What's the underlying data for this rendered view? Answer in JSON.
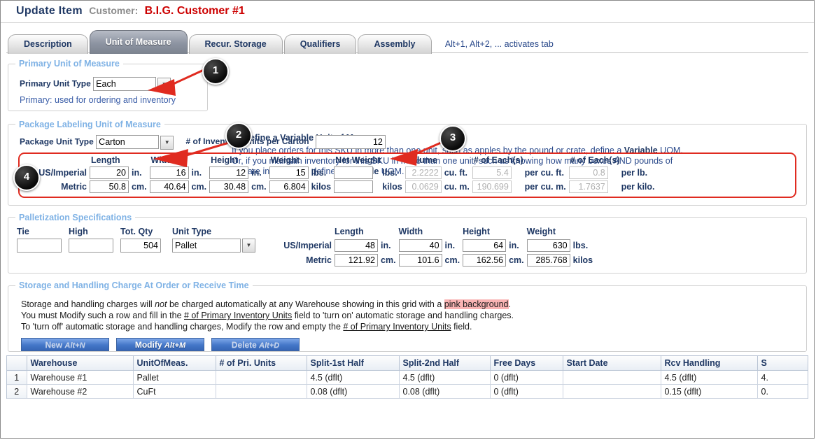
{
  "header": {
    "title_update": "Update",
    "title_item": "Item",
    "customer_label": "Customer:",
    "customer_name": "B.I.G. Customer #1"
  },
  "tabs": [
    {
      "label": "Description",
      "active": false
    },
    {
      "label": "Unit of Measure",
      "active": true
    },
    {
      "label": "Recur. Storage",
      "active": false
    },
    {
      "label": "Qualifiers",
      "active": false
    },
    {
      "label": "Assembly",
      "active": false
    }
  ],
  "tab_hint": "Alt+1, Alt+2, ... activates tab",
  "primary_uom": {
    "legend": "Primary Unit of Measure",
    "unit_type_label": "Primary Unit Type",
    "unit_type_value": "Each",
    "note": "Primary: used for ordering and inventory"
  },
  "variable_uom": {
    "checkbox_label": "Define a Variable Unit of Measure",
    "checked": false,
    "body_1": "If you place orders for this SKU in more than one unit, such as apples by the pound or crate, define a ",
    "body_b1": "Variable",
    "body_2": " UOM. Or, if you maintain inventory for this SKU in more than one unit, such as knowing how many boxes AND pounds of fish are in inventory, define a ",
    "body_b2": "Variable",
    "body_3": " UOM."
  },
  "package_uom": {
    "legend": "Package Labeling Unit of Measure",
    "unit_type_label": "Package Unit Type",
    "unit_type_value": "Carton",
    "inv_units_label": "# of Inventory Units per Carton",
    "inv_units_value": "12",
    "columns": [
      "Length",
      "Width",
      "Height",
      "Weight",
      "Net Weight",
      "Volume",
      "# of Each(s)",
      "# of Each(s)"
    ],
    "rows": [
      {
        "label": "US/Imperial",
        "length": "20",
        "length_unit": "in.",
        "width": "16",
        "width_unit": "in.",
        "height": "12",
        "height_unit": "in.",
        "weight": "15",
        "weight_unit": "lbs.",
        "net_weight": "",
        "net_weight_unit": "lbs.",
        "volume": "2.2222",
        "volume_unit": "cu. ft.",
        "each1": "5.4",
        "each1_unit": "per cu. ft.",
        "each2": "0.8",
        "each2_unit": "per lb."
      },
      {
        "label": "Metric",
        "length": "50.8",
        "length_unit": "cm.",
        "width": "40.64",
        "width_unit": "cm.",
        "height": "30.48",
        "height_unit": "cm.",
        "weight": "6.804",
        "weight_unit": "kilos",
        "net_weight": "",
        "net_weight_unit": "kilos",
        "volume": "0.0629",
        "volume_unit": "cu. m.",
        "each1": "190.699",
        "each1_unit": "per cu. m.",
        "each2": "1.7637",
        "each2_unit": "per kilo."
      }
    ]
  },
  "palletization": {
    "legend": "Palletization Specifications",
    "tie_label": "Tie",
    "tie_value": "",
    "high_label": "High",
    "high_value": "",
    "tot_qty_label": "Tot. Qty",
    "tot_qty_value": "504",
    "unit_type_label": "Unit Type",
    "unit_type_value": "Pallet",
    "columns": [
      "Length",
      "Width",
      "Height",
      "Weight"
    ],
    "rows": [
      {
        "label": "US/Imperial",
        "length": "48",
        "length_unit": "in.",
        "width": "40",
        "width_unit": "in.",
        "height": "64",
        "height_unit": "in.",
        "weight": "630",
        "weight_unit": "lbs."
      },
      {
        "label": "Metric",
        "length": "121.92",
        "length_unit": "cm.",
        "width": "101.6",
        "width_unit": "cm.",
        "height": "162.56",
        "height_unit": "cm.",
        "weight": "285.768",
        "weight_unit": "kilos"
      }
    ]
  },
  "storage": {
    "legend": "Storage and Handling Charge At Order or Receive Time",
    "line1_a": "Storage and handling charges will ",
    "line1_not": "not",
    "line1_b": " be charged automatically at any Warehouse showing in this grid with a ",
    "line1_pink": "pink background",
    "line1_c": ".",
    "line2_a": "You must Modify such a row and fill in the ",
    "line2_link": "# of Primary Inventory Units",
    "line2_b": " field to 'turn on' automatic storage and handling charges.",
    "line3_a": "To 'turn off' automatic storage and handling charges, Modify the row and empty the ",
    "line3_link": "# of Primary Inventory Units",
    "line3_b": " field.",
    "buttons": [
      {
        "label": "New",
        "accel": "Alt+N",
        "disabled": true
      },
      {
        "label": "Modify",
        "accel": "Alt+M",
        "disabled": false
      },
      {
        "label": "Delete",
        "accel": "Alt+D",
        "disabled": true
      }
    ],
    "grid": {
      "columns": [
        "",
        "Warehouse",
        "UnitOfMeas.",
        "# of Pri. Units",
        "Split-1st Half",
        "Split-2nd Half",
        "Free Days",
        "Start Date",
        "Rcv Handling",
        "S"
      ],
      "rows": [
        {
          "num": "1",
          "warehouse": "Warehouse #1",
          "uom": "Pallet",
          "pri_units": "",
          "split1": "4.5 (dflt)",
          "split2": "4.5 (dflt)",
          "free_days": "0 (dflt)",
          "start_date": "",
          "rcv_handling": "4.5 (dflt)",
          "last": "4."
        },
        {
          "num": "2",
          "warehouse": "Warehouse #2",
          "uom": "CuFt",
          "pri_units": "",
          "split1": "0.08 (dflt)",
          "split2": "0.08 (dflt)",
          "free_days": "0 (dflt)",
          "start_date": "",
          "rcv_handling": "0.15 (dflt)",
          "last": "0."
        }
      ]
    }
  },
  "callouts": [
    {
      "number": "1"
    },
    {
      "number": "2"
    },
    {
      "number": "3"
    },
    {
      "number": "4"
    }
  ],
  "colors": {
    "accent_red": "#cc0000",
    "legend_blue": "#7fb2e5",
    "text_blue": "#1f3864",
    "highlight_pink": "#f9b3b3",
    "callout_arrow": "#e02b20"
  }
}
